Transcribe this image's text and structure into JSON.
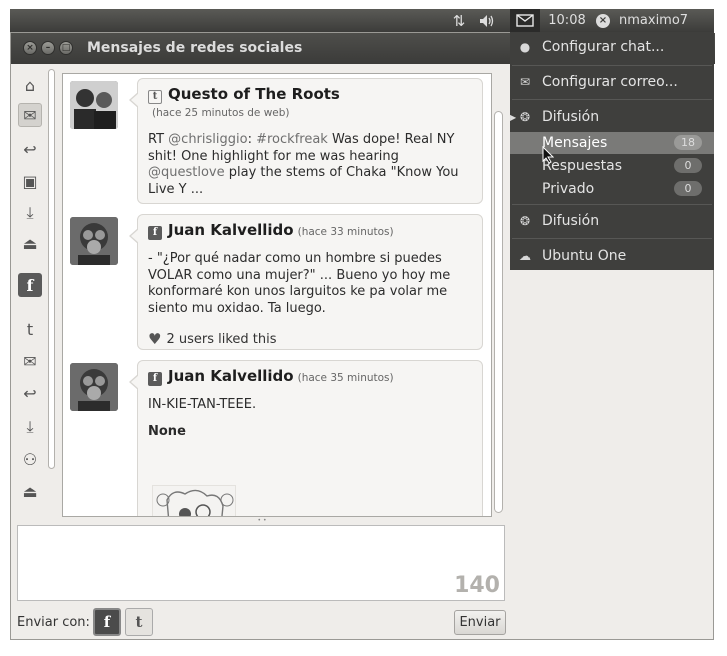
{
  "top_panel": {
    "network_icon": "network-arrows-icon",
    "volume_icon": "speaker-icon",
    "messages_icon": "envelope-icon",
    "clock": "10:08",
    "user": "nmaximo7"
  },
  "window": {
    "title": "Mensajes de redes sociales"
  },
  "rail": {
    "icons": [
      "home-icon",
      "inbox-icon",
      "reply-icon",
      "image-icon",
      "download-icon",
      "eject-icon",
      "facebook-icon",
      "twitter-icon",
      "inbox-icon",
      "reply-icon",
      "download-icon",
      "users-icon",
      "eject-icon"
    ]
  },
  "posts": [
    {
      "source": "twitter",
      "source_glyph": "t",
      "author": "Questo of The Roots",
      "time": "(hace 25 minutos de web)",
      "text_parts": [
        "RT ",
        "@chrisliggio",
        ": ",
        "#rockfreak",
        " Was dope! Real NY shit! One highlight for me was hearing ",
        "@questlove",
        " play the stems of Chaka \"Know You Live Y ..."
      ]
    },
    {
      "source": "facebook",
      "source_glyph": "f",
      "author": "Juan Kalvellido",
      "time": "(hace 33 minutos)",
      "text": "- \"¿Por qué nadar como un hombre si puedes VOLAR como una mujer?\" ... Bueno yo hoy me konformaré kon unos larguitos ke pa volar me siento mu oxidao. Ta luego.",
      "likes": "2 users liked this"
    },
    {
      "source": "facebook",
      "source_glyph": "f",
      "author": "Juan Kalvellido",
      "time": "(hace 35 minutos)",
      "text": "IN-KIE-TAN-TEEE.",
      "bold": "None"
    }
  ],
  "compose": {
    "char_count": "140"
  },
  "send_bar": {
    "label": "Enviar con:",
    "facebook_glyph": "f",
    "twitter_glyph": "t",
    "send_label": "Enviar"
  },
  "menu": {
    "items": [
      {
        "icon": "chat-bubble-icon",
        "label": "Configurar chat..."
      },
      {
        "icon": "envelope-icon",
        "label": "Configurar correo..."
      },
      {
        "icon": "gwibber-icon",
        "label": "Difusión"
      },
      {
        "label": "Mensajes",
        "count": "18"
      },
      {
        "label": "Respuestas",
        "count": "0"
      },
      {
        "label": "Privado",
        "count": "0"
      },
      {
        "icon": "gwibber-icon",
        "label": "Difusión"
      },
      {
        "icon": "ubuntu-one-icon",
        "label": "Ubuntu One"
      }
    ]
  },
  "colors": {
    "panel": "#3c3c3a",
    "menu_bg": "#3f3f3d",
    "menu_highlight": "#7a7a78",
    "window_bg": "#efedea"
  }
}
